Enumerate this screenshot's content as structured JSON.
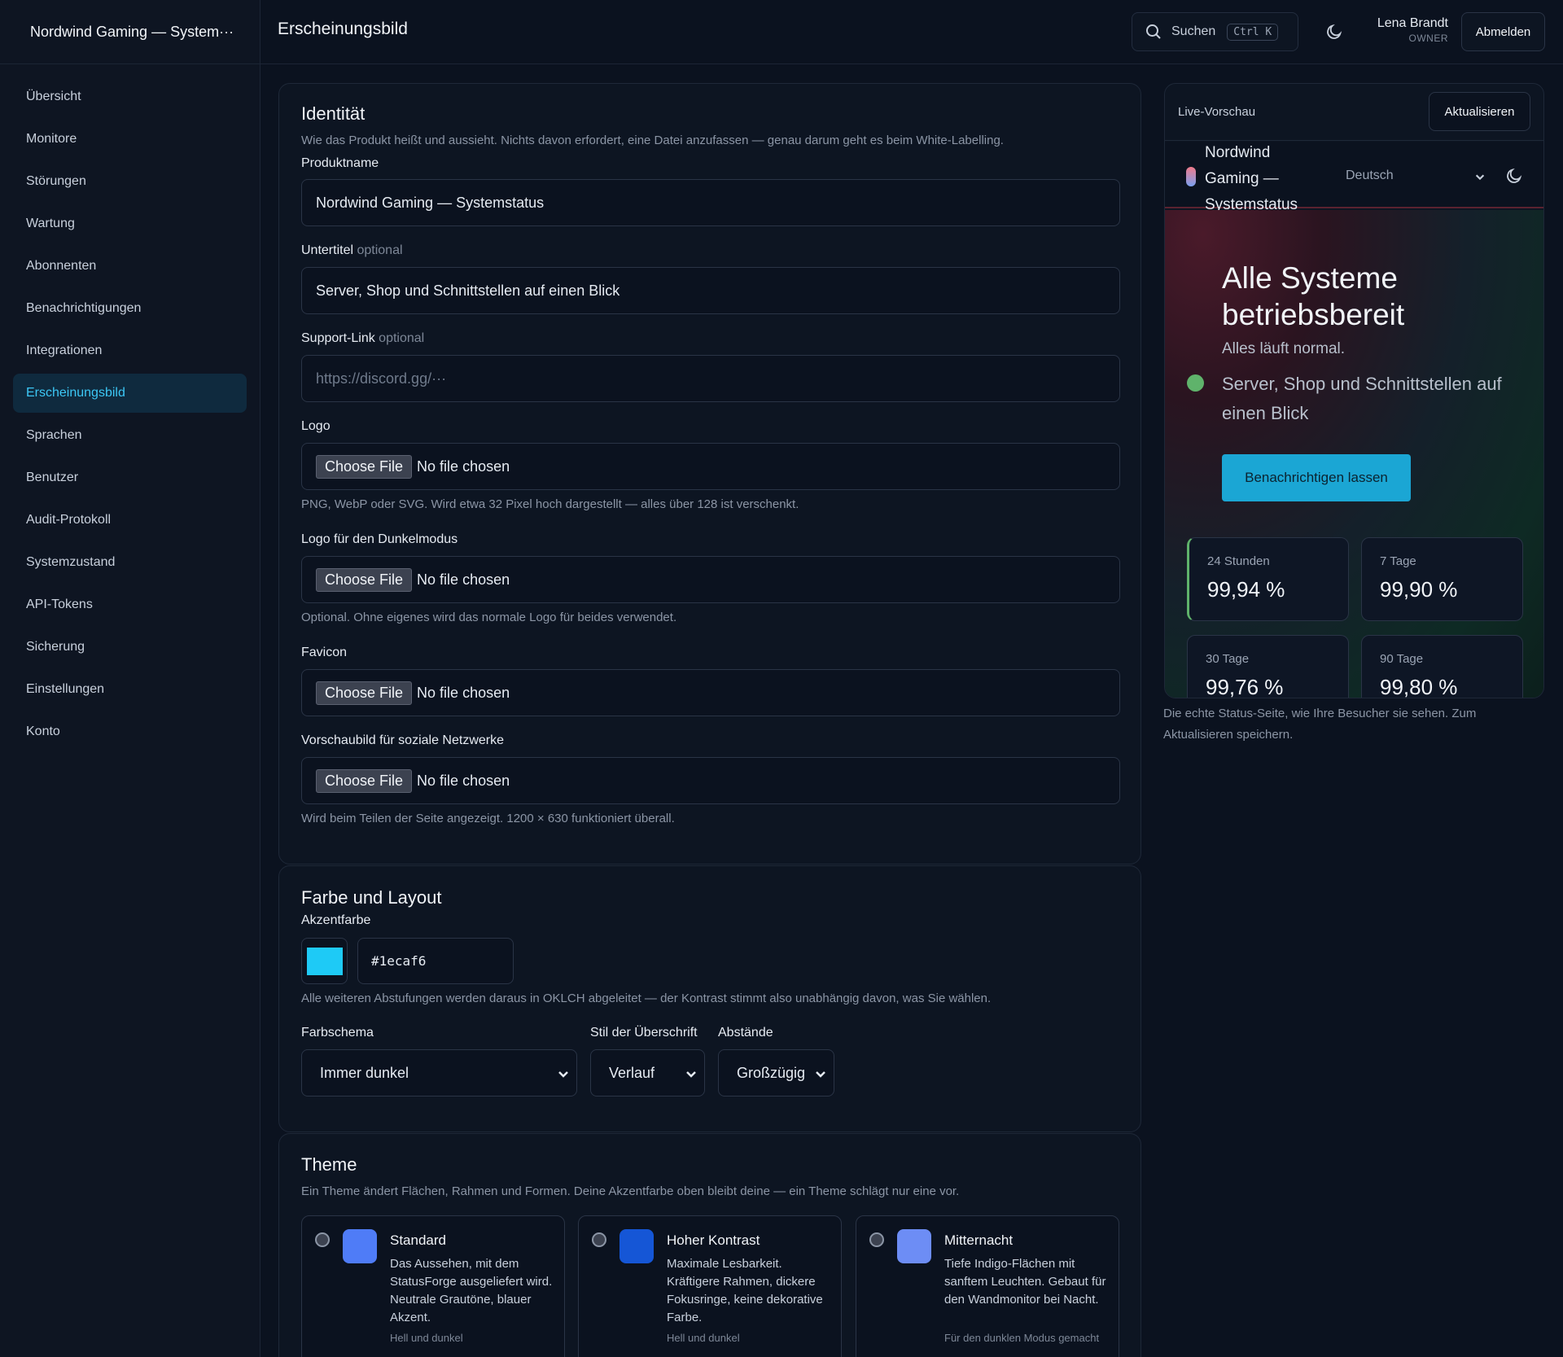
{
  "sidebar": {
    "brand": "Nordwind Gaming — System···",
    "items": [
      {
        "label": "Übersicht"
      },
      {
        "label": "Monitore"
      },
      {
        "label": "Störungen"
      },
      {
        "label": "Wartung"
      },
      {
        "label": "Abonnenten"
      },
      {
        "label": "Benachrichtigungen"
      },
      {
        "label": "Integrationen"
      },
      {
        "label": "Erscheinungsbild"
      },
      {
        "label": "Sprachen"
      },
      {
        "label": "Benutzer"
      },
      {
        "label": "Audit-Protokoll"
      },
      {
        "label": "Systemzustand"
      },
      {
        "label": "API-Tokens"
      },
      {
        "label": "Sicherung"
      },
      {
        "label": "Einstellungen"
      },
      {
        "label": "Konto"
      }
    ],
    "active_index": 7
  },
  "topbar": {
    "title": "Erscheinungsbild",
    "search_label": "Suchen",
    "search_shortcut": "Ctrl K",
    "user_name": "Lena Brandt",
    "user_role": "OWNER",
    "logout_label": "Abmelden"
  },
  "identity": {
    "title": "Identität",
    "description": "Wie das Produkt heißt und aussieht. Nichts davon erfordert, eine Datei anzufassen — genau darum geht es beim White-Labelling.",
    "product_name_label": "Produktname",
    "product_name_value": "Nordwind Gaming — Systemstatus",
    "subtitle_label": "Untertitel",
    "optional": "optional",
    "subtitle_value": "Server, Shop und Schnittstellen auf einen Blick",
    "support_label": "Support-Link",
    "support_placeholder": "https://discord.gg/···",
    "choose_file": "Choose File",
    "no_file": "No file chosen",
    "logo_label": "Logo",
    "logo_hint": "PNG, WebP oder SVG. Wird etwa 32 Pixel hoch dargestellt — alles über 128 ist verschenkt.",
    "dark_logo_label": "Logo für den Dunkelmodus",
    "dark_logo_hint": "Optional. Ohne eigenes wird das normale Logo für beides verwendet.",
    "favicon_label": "Favicon",
    "social_label": "Vorschaubild für soziale Netzwerke",
    "social_hint": "Wird beim Teilen der Seite angezeigt. 1200 × 630 funktioniert überall."
  },
  "color_layout": {
    "title": "Farbe und Layout",
    "accent_label": "Akzentfarbe",
    "accent_value": "#1ecaf6",
    "accent_hint": "Alle weiteren Abstufungen werden daraus in OKLCH abgeleitet — der Kontrast stimmt also unabhängig davon, was Sie wählen.",
    "scheme_label": "Farbschema",
    "scheme_value": "Immer dunkel",
    "heading_label": "Stil der Überschrift",
    "heading_value": "Verlauf",
    "spacing_label": "Abstände",
    "spacing_value": "Großzügig"
  },
  "theme": {
    "title": "Theme",
    "description": "Ein Theme ändert Flächen, Rahmen und Formen. Deine Akzentfarbe oben bleibt deine — ein Theme schlägt nur eine vor.",
    "options": [
      {
        "name": "Standard",
        "desc": "Das Aussehen, mit dem StatusForge ausgeliefert wird. Neutrale Grautöne, blauer Akzent.",
        "mode": "Hell und dunkel",
        "color": "#4f7cf7"
      },
      {
        "name": "Hoher Kontrast",
        "desc": "Maximale Lesbarkeit. Kräftigere Rahmen, dickere Fokusringe, keine dekorative Farbe.",
        "mode": "Hell und dunkel",
        "color": "#1556d6"
      },
      {
        "name": "Mitternacht",
        "desc": "Tiefe Indigo-Flächen mit sanftem Leuchten. Gebaut für den Wandmonitor bei Nacht.",
        "mode": "Für den dunklen Modus gemacht",
        "color": "#6d8df5"
      }
    ]
  },
  "preview": {
    "label": "Live-Vorschau",
    "refresh_label": "Aktualisieren",
    "brand": "Nordwind Gaming — Systemstatus",
    "language": "Deutsch",
    "headline": "Alle Systeme betriebsbereit",
    "subline": "Alles läuft normal.",
    "tagline": "Server, Shop und Schnittstellen auf einen Blick",
    "cta": "Benachrichtigen lassen",
    "stats": [
      {
        "label": "24 Stunden",
        "value": "99,94 %"
      },
      {
        "label": "7 Tage",
        "value": "99,90 %"
      },
      {
        "label": "30 Tage",
        "value": "99,76 %"
      },
      {
        "label": "90 Tage",
        "value": "99,80 %"
      }
    ],
    "note": "Die echte Status-Seite, wie Ihre Besucher sie sehen. Zum Aktualisieren speichern."
  }
}
